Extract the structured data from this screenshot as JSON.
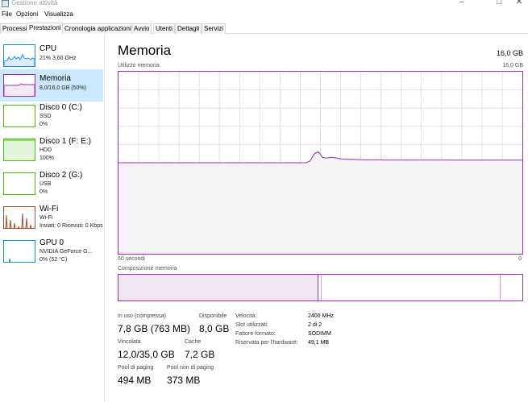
{
  "window": {
    "title": "Gestione attività"
  },
  "menu": [
    "File",
    "Opzioni",
    "Visualizza"
  ],
  "tabs": [
    "Processi",
    "Prestazioni",
    "Cronologia applicazioni",
    "Avvio",
    "Utenti",
    "Dettagli",
    "Servizi"
  ],
  "active_tab": "Prestazioni",
  "sidebar": [
    {
      "name": "CPU",
      "sub1": "21% 3,60 GHz",
      "sub2": "",
      "color": "#1a8fd2"
    },
    {
      "name": "Memoria",
      "sub1": "8,0/16,0 GB (50%)",
      "sub2": "",
      "color": "#9b30b2"
    },
    {
      "name": "Disco 0 (C:)",
      "sub1": "SSD",
      "sub2": "0%",
      "color": "#4cbb17"
    },
    {
      "name": "Disco 1 (F: E:)",
      "sub1": "HDD",
      "sub2": "100%",
      "color": "#4cbb17"
    },
    {
      "name": "Disco 2 (G:)",
      "sub1": "USB",
      "sub2": "0%",
      "color": "#4cbb17"
    },
    {
      "name": "Wi-Fi",
      "sub1": "Wi-Fi",
      "sub2": "Inviati: 0 Ricevuti: 0 Kbps",
      "color": "#a0522d"
    },
    {
      "name": "GPU 0",
      "sub1": "NVIDIA GeForce G...",
      "sub2": "0% (52 °C)",
      "color": "#1a8fd2"
    }
  ],
  "main": {
    "title": "Memoria",
    "total": "16,0 GB",
    "usage_label": "Utilizzo memoria",
    "usage_max": "16,0 GB",
    "time_left": "60 secondi",
    "time_right": "0",
    "composition_label": "Composizione memoria",
    "usage_series": [
      50,
      50,
      50,
      50,
      50,
      50,
      50,
      50,
      50,
      50,
      50,
      50,
      50,
      50,
      50,
      50,
      50,
      50,
      50,
      50,
      50,
      50,
      50,
      50,
      50,
      50,
      50,
      50,
      50,
      50,
      50,
      50,
      50,
      50,
      50,
      50,
      50,
      50,
      50,
      50,
      50,
      50,
      50,
      50,
      50,
      50,
      50,
      51,
      55,
      56,
      53,
      52.5,
      53,
      52.8,
      52.3,
      52,
      51.9,
      51.8,
      51.8,
      51.7,
      51.7,
      51.6,
      51.6,
      51.6,
      51.6,
      51.5,
      51.5,
      51.5,
      51.5,
      51.5,
      51.5,
      51.5,
      51.5,
      51.5,
      51.5,
      51.5,
      51.5,
      51.5,
      51.5,
      51.5,
      51.5,
      51.4,
      51.4,
      51.4,
      51.4,
      51.4,
      51.4,
      51.4,
      51.4,
      51.4,
      51.4,
      51.4,
      51.4,
      51.4,
      51.4,
      51.4,
      51.4,
      51.4,
      51.4,
      51.4
    ],
    "stats": {
      "in_use_label": "In uso (compressa)",
      "in_use": "7,8 GB (763 MB)",
      "available_label": "Disponibile",
      "available": "8,0 GB",
      "committed_label": "Vincolata",
      "committed": "12,0/35,0 GB",
      "cache_label": "Cache",
      "cache": "7,2 GB",
      "paged_label": "Pool di paging",
      "paged": "494 MB",
      "nonpaged_label": "Pool non di paging",
      "nonpaged": "373 MB"
    },
    "details": [
      {
        "label": "Velocità:",
        "value": "2400 MHz"
      },
      {
        "label": "Slot utilizzati:",
        "value": "2 di 2"
      },
      {
        "label": "Fattore formato:",
        "value": "SODIMM"
      },
      {
        "label": "Riservata per l'hardware:",
        "value": "49,1 MB"
      }
    ]
  },
  "colors": {
    "memory": "#9b30b2",
    "memory_fill": "#f4f2f4",
    "selected": "#cce8ff"
  }
}
